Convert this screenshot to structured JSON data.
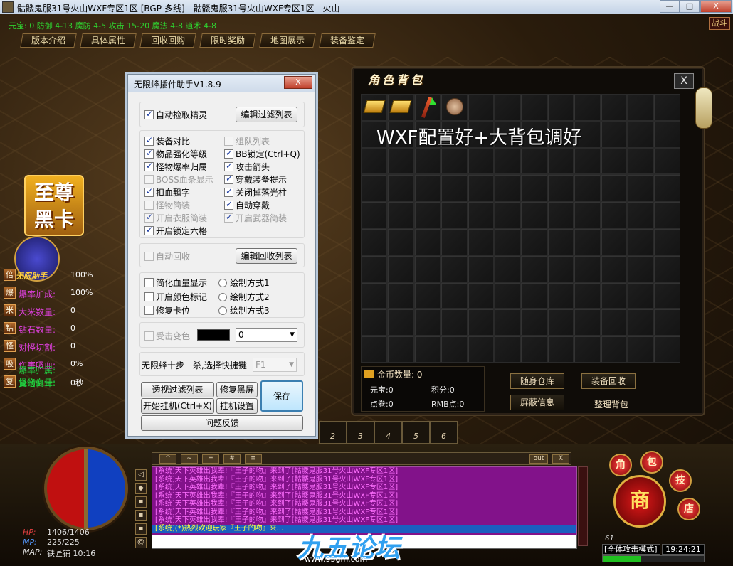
{
  "window": {
    "title": "骷髅鬼服31号火山WXF专区1区  [BGP-多线]  - 骷髅鬼服31号火山WXF专区1区 - 火山",
    "min_label": "—",
    "max_label": "□",
    "close_label": "X"
  },
  "stats_line": "元宝: 0 防御 4-13 魔防 4-5 攻击 15-20 魔法 4-8 道术 4-8",
  "battle_label": "战斗",
  "tabs": [
    "版本介绍",
    "具体属性",
    "回收回购",
    "限时奖励",
    "地图展示",
    "装备鉴定"
  ],
  "vip_badge": {
    "line1": "至尊",
    "line2": "黑卡"
  },
  "assist_label": "无限助手",
  "left_stats": [
    {
      "icon": "倍",
      "label": "",
      "value": "100%",
      "color": "green"
    },
    {
      "icon": "爆",
      "label": "爆率加成:",
      "value": "100%",
      "color": "magenta"
    },
    {
      "icon": "米",
      "label": "大米数量:",
      "value": "0",
      "color": "magenta"
    },
    {
      "icon": "钻",
      "label": "钻石数量:",
      "value": "0",
      "color": "magenta"
    },
    {
      "icon": "怪",
      "label": "对怪切割:",
      "value": "0",
      "color": "magenta"
    },
    {
      "icon": "吸",
      "label": "伤害吸血:",
      "value": "0%",
      "color": "magenta"
    },
    {
      "icon": "复",
      "label": "复活倒计:",
      "value": "0秒",
      "color": "green"
    }
  ],
  "left_extra": [
    "爆率归属:",
    "怪物血量:"
  ],
  "plugin": {
    "title": "无限蜂插件助手V1.8.9",
    "close": "X",
    "auto_pick": "自动捡取精灵",
    "edit_filter": "编辑过滤列表",
    "options": [
      {
        "label": "装备对比",
        "checked": true,
        "disabled": false
      },
      {
        "label": "组队列表",
        "checked": false,
        "disabled": true
      },
      {
        "label": "物品强化等级",
        "checked": true,
        "disabled": false
      },
      {
        "label": "BB锁定(Ctrl+Q)",
        "checked": true,
        "disabled": false
      },
      {
        "label": "怪物爆率归属",
        "checked": true,
        "disabled": false
      },
      {
        "label": "攻击箭头",
        "checked": true,
        "disabled": false
      },
      {
        "label": "BOSS血条显示",
        "checked": false,
        "disabled": true
      },
      {
        "label": "穿戴装备提示",
        "checked": true,
        "disabled": false
      },
      {
        "label": "扣血飘字",
        "checked": true,
        "disabled": false
      },
      {
        "label": "关闭掉落光柱",
        "checked": true,
        "disabled": false
      },
      {
        "label": "怪物简装",
        "checked": false,
        "disabled": true
      },
      {
        "label": "自动穿戴",
        "checked": true,
        "disabled": false
      },
      {
        "label": "开启衣服简装",
        "checked": true,
        "disabled": true
      },
      {
        "label": "开启武器简装",
        "checked": true,
        "disabled": true
      },
      {
        "label": "开启锁定六格",
        "checked": true,
        "disabled": false
      }
    ],
    "auto_recycle": "自动回收",
    "edit_recycle": "编辑回收列表",
    "display_opts": [
      "简化血量显示",
      "开启颜色标记",
      "修复卡位"
    ],
    "draw_modes": [
      "绘制方式1",
      "绘制方式2",
      "绘制方式3"
    ],
    "hit_color": "受击变色",
    "hit_color_value": "0",
    "hotkey_label": "无限蜂十步一杀,选择快捷键",
    "hotkey_value": "F1",
    "btn_perspective": "透视过滤列表",
    "btn_fix_black": "修复黑屏",
    "btn_save": "保存",
    "btn_hangup": "开始挂机(Ctrl+X)",
    "btn_hang_settings": "挂机设置",
    "btn_feedback": "问题反馈"
  },
  "bag": {
    "title": "角色背包",
    "close": "X",
    "overlay": "WXF配置好+大背包调好",
    "gold_label": "金币数量:",
    "gold_value": "0",
    "yuanbao": "元宝:0",
    "jifen": "积分:0",
    "dianjuan": "点卷:0",
    "rmb": "RMB点:0",
    "btn_storage": "随身仓库",
    "btn_recycle": "装备回收",
    "btn_shield": "屏蔽信息",
    "btn_tidy": "整理背包"
  },
  "pagebar": [
    "2",
    "3",
    "4",
    "5",
    "6"
  ],
  "chat": {
    "toolbar_out": "out",
    "toolbar_close": "X",
    "lines": [
      "[系统]天下英雄出我辈!『王子的吻』来到了[骷髅鬼服31号火山WXF专区1区]",
      "[系统]天下英雄出我辈!『王子的吻』来到了[骷髅鬼服31号火山WXF专区1区]",
      "[系统]天下英雄出我辈!『王子的吻』来到了[骷髅鬼服31号火山WXF专区1区]",
      "[系统]天下英雄出我辈!『王子的吻』来到了[骷髅鬼服31号火山WXF专区1区]",
      "[系统]天下英雄出我辈!『王子的吻』来到了[骷髅鬼服31号火山WXF专区1区]",
      "[系统]天下英雄出我辈!『王子的吻』来到了[骷髅鬼服31号火山WXF专区1区]",
      "[系统]天下英雄出我辈!『王子的吻』来到了[骷髅鬼服31号火山WXF专区1区]"
    ],
    "highlight": "[系统](*)热烈欢迎玩家『王子的吻』来..."
  },
  "hud": {
    "hp": "1406/1406",
    "mp": "225/225",
    "map": "铁匠铺 10:16"
  },
  "watermark": "九五论坛",
  "watermark_url": "www.95gm.com",
  "ring": {
    "top1": "角",
    "top2": "包",
    "right1": "技",
    "right2": "店",
    "main": "商"
  },
  "level": "61",
  "mode": "[全体攻击模式]",
  "clock": "19:24:21",
  "exp_fraction": 0.38
}
